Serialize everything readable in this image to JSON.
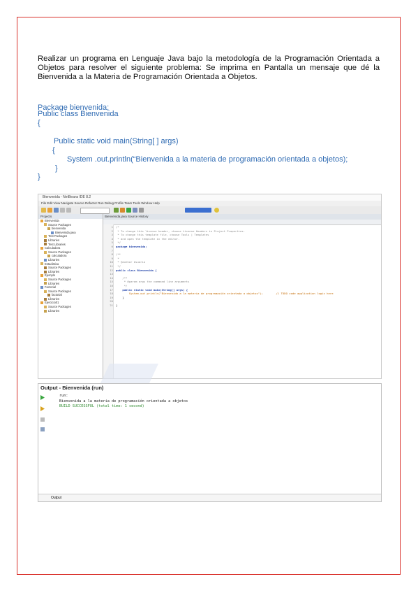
{
  "problem_statement": "Realizar un programa en Lenguaje Java bajo la metodología de la Programación Orientada a Objetos para resolver el siguiente problema: Se imprima en Pantalla un mensaje que dé la Bienvenida a la Materia de Programación Orientada a Objetos.",
  "code_listing": {
    "line1": "Package bienvenida;",
    "line2": "Public class Bienvenida",
    "line3": "{",
    "line4": "Public static void main(String[ ] args)",
    "line5": "{",
    "line6": "System .out.println(“Bienvenida a la materia de programación orientada a objetos);",
    "line7": "}",
    "line8": "}"
  },
  "ide_screenshot": {
    "window_title": "Bienvenida - NetBeans IDE 8.2",
    "menu_items": [
      "File",
      "Edit",
      "View",
      "Navigate",
      "Source",
      "Refactor",
      "Run",
      "Debug",
      "Profile",
      "Team",
      "Tools",
      "Window",
      "Help"
    ],
    "project_panel_title": "Projects",
    "project_tree": [
      "Bienvenida",
      "Source Packages",
      "bienvenida",
      "Bienvenida.java",
      "Test Packages",
      "Libraries",
      "Test Libraries",
      "Calculadora",
      "Source Packages",
      "calculadora",
      "Libraries",
      "Estadistica",
      "Source Packages",
      "Libraries",
      "Ejemplo",
      "Source Packages",
      "Libraries",
      "Factorial",
      "Source Packages",
      "factorial",
      "Libraries",
      "Ejercicio01",
      "Source Packages",
      "Libraries"
    ],
    "editor_tabs": [
      "Bienvenida.java",
      "Source",
      "History"
    ],
    "editor_lines": [
      {
        "n": "1",
        "cls": "cm",
        "text": "/*"
      },
      {
        "n": "2",
        "cls": "cm",
        "text": " * To change this license header, choose License Headers in Project Properties."
      },
      {
        "n": "3",
        "cls": "cm",
        "text": " * To change this template file, choose Tools | Templates"
      },
      {
        "n": "4",
        "cls": "cm",
        "text": " * and open the template in the editor."
      },
      {
        "n": "5",
        "cls": "cm",
        "text": " */"
      },
      {
        "n": "6",
        "cls": "kw",
        "text": "package bienvenida;"
      },
      {
        "n": "7",
        "cls": "tx",
        "text": ""
      },
      {
        "n": "8",
        "cls": "cm",
        "text": "/**"
      },
      {
        "n": "9",
        "cls": "cm",
        "text": " *"
      },
      {
        "n": "10",
        "cls": "cm",
        "text": " * @author Usuario"
      },
      {
        "n": "11",
        "cls": "cm",
        "text": " */"
      },
      {
        "n": "12",
        "cls": "kw",
        "text": "public class Bienvenida {"
      },
      {
        "n": "13",
        "cls": "tx",
        "text": ""
      },
      {
        "n": "14",
        "cls": "cm",
        "text": "    /**"
      },
      {
        "n": "15",
        "cls": "cm",
        "text": "     * @param args the command line arguments"
      },
      {
        "n": "16",
        "cls": "cm",
        "text": "     */"
      },
      {
        "n": "17",
        "cls": "kw",
        "text": "    public static void main(String[] args) {"
      },
      {
        "n": "18",
        "cls": "st",
        "text": "        System.out.println(\"Bienvenida a la materia de programación orientada a objetos\");        // TODO code application logic here"
      },
      {
        "n": "19",
        "cls": "tx",
        "text": "    }"
      },
      {
        "n": "20",
        "cls": "tx",
        "text": ""
      },
      {
        "n": "21",
        "cls": "tx",
        "text": "}"
      }
    ]
  },
  "output_panel": {
    "title": "Output - Bienvenida (run)",
    "lines": [
      "run:",
      "Bienvenida a la materia de programación orientada a objetos",
      "BUILD SUCCESSFUL (total time: 1 second)"
    ],
    "bottom_tab": "Output"
  },
  "colors": {
    "border": "#d9302a",
    "code": "#2f6bb3",
    "build_ok": "#2f8a2f"
  }
}
